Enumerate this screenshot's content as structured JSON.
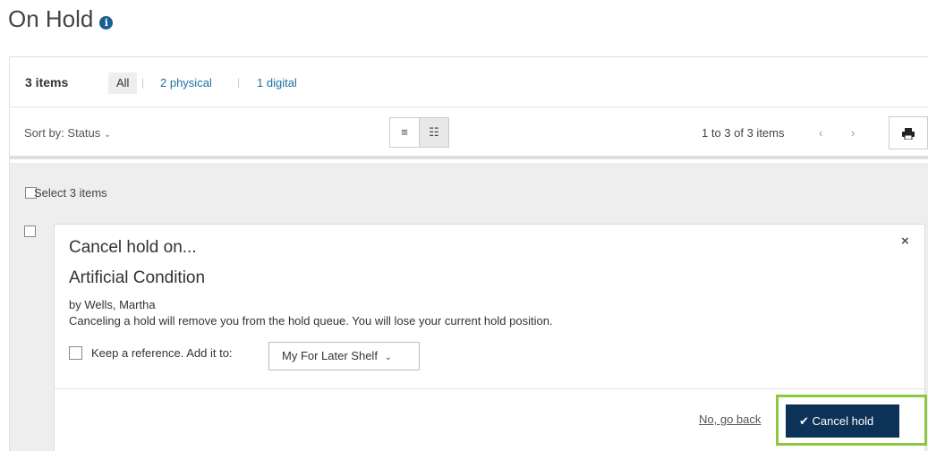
{
  "header": {
    "title": "On Hold",
    "info_icon": "info-icon"
  },
  "filters": {
    "item_count": "3 items",
    "all_label": "All",
    "separator": "|",
    "physical_label": "2 physical",
    "digital_label": "1 digital"
  },
  "toolbar": {
    "sort_label": "Sort by: Status",
    "list_view_icon": "list-view-icon",
    "detail_view_icon": "detail-view-icon",
    "pagination_text": "1 to 3 of 3 items",
    "prev_icon": "‹",
    "next_icon": "›",
    "print_icon": "print-icon"
  },
  "list": {
    "select_all_label": "Select 3 items"
  },
  "dialog": {
    "heading": "Cancel hold on...",
    "close_symbol": "×",
    "book_title": "Artificial Condition",
    "author": "by Wells, Martha",
    "message": "Canceling a hold will remove you from the hold queue. You will lose your current hold position.",
    "keep_label": "Keep a reference. Add it to:",
    "shelf_value": "My For Later Shelf",
    "no_go_back": "No, go back",
    "cancel_hold": "Cancel hold"
  },
  "colors": {
    "primary_button": "#0d3257",
    "link": "#1d6fa5",
    "highlight_border": "#8dc63f",
    "info_icon": "#1a5f8f"
  }
}
